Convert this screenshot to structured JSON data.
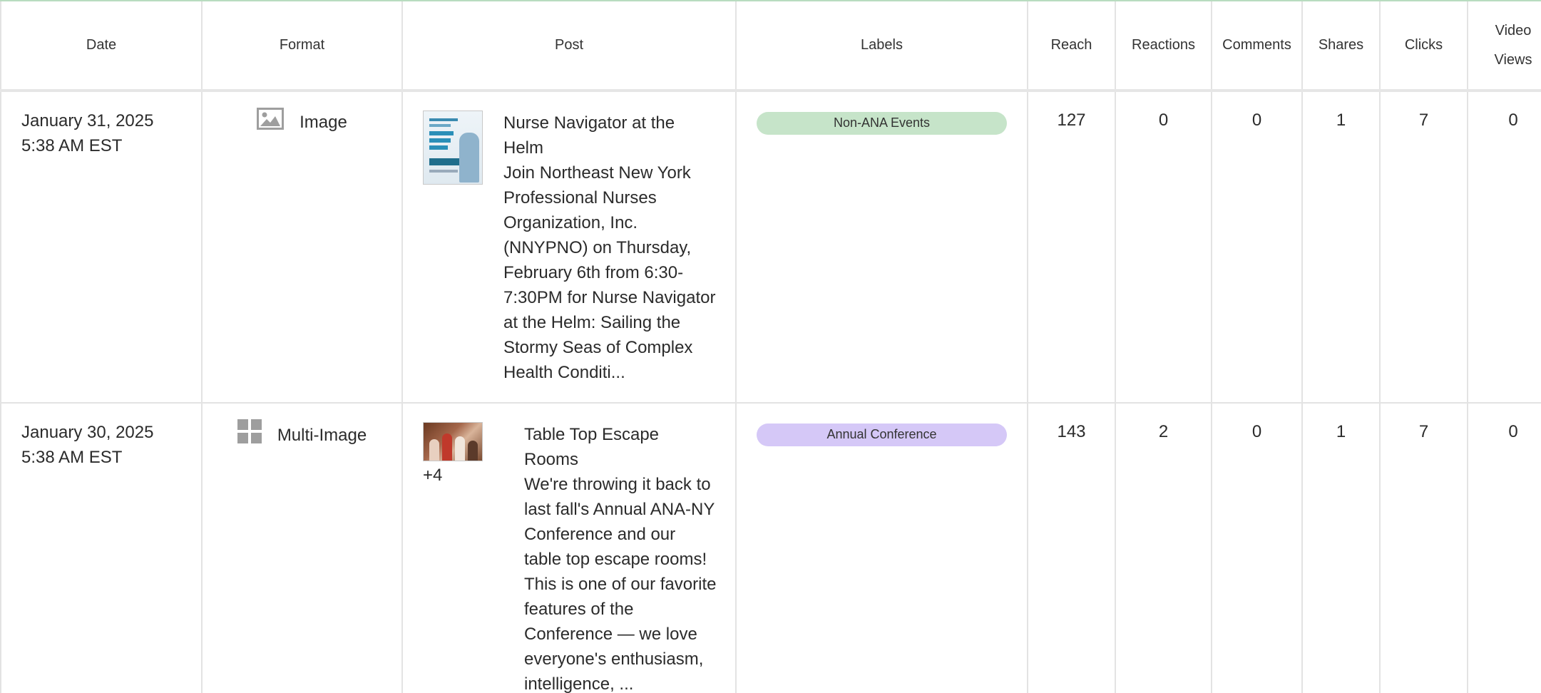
{
  "columns": {
    "date": "Date",
    "format": "Format",
    "post": "Post",
    "labels": "Labels",
    "reach": "Reach",
    "reactions": "Reactions",
    "comments": "Comments",
    "shares": "Shares",
    "clicks": "Clicks",
    "video_views_1": "Video",
    "video_views_2": "Views"
  },
  "colors": {
    "non_ana_events": "#c6e4c9",
    "annual_conference": "#d5c8f7",
    "header_top_border": "#b8dcbf"
  },
  "rows": [
    {
      "date": "January 31, 2025",
      "time": "5:38 AM EST",
      "format": "Image",
      "format_icon": "image-icon",
      "post_title": "Nurse Navigator at the Helm",
      "post_body": "Join Northeast New York Professional Nurses Organization, Inc. (NNYPNO) on Thursday, February 6th from 6:30-7:30PM for Nurse Navigator at the Helm: Sailing the Stormy Seas of Complex Health Conditi...",
      "label": "Non-ANA Events",
      "reach": "127",
      "reactions": "0",
      "comments": "0",
      "shares": "1",
      "clicks": "7",
      "video_views": "0"
    },
    {
      "date": "January 30, 2025",
      "time": "5:38 AM EST",
      "format": "Multi-Image",
      "format_icon": "grid-icon",
      "extra_images": "+4",
      "post_title": "Table Top Escape Rooms",
      "post_body": "We're throwing it back to last fall's Annual ANA-NY Conference and our table top escape rooms! This is one of our favorite features of the Conference — we love everyone's enthusiasm, intelligence, ...",
      "label": "Annual Conference",
      "reach": "143",
      "reactions": "2",
      "comments": "0",
      "shares": "1",
      "clicks": "7",
      "video_views": "0"
    }
  ]
}
